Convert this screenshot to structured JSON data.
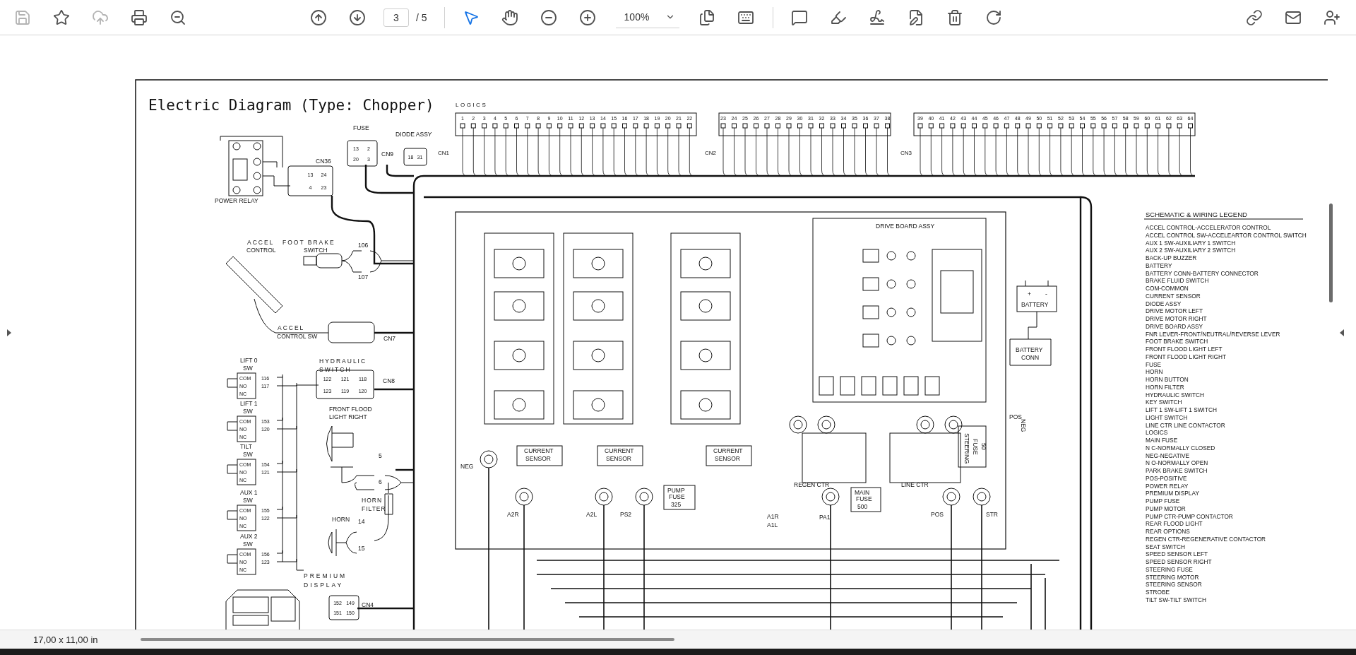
{
  "toolbar": {
    "page_current": "3",
    "page_total": "/ 5",
    "zoom": "100%"
  },
  "diagram": {
    "title": "Electric Diagram (Type: Chopper)",
    "logics_label": "LOGICS",
    "logic_groups": [
      {
        "connector": "CN1",
        "pins": [
          "1",
          "2",
          "3",
          "4",
          "5",
          "6",
          "7",
          "8",
          "9",
          "10",
          "11",
          "12",
          "13",
          "14",
          "15",
          "16",
          "17",
          "18",
          "19",
          "20",
          "21",
          "22"
        ]
      },
      {
        "connector": "CN2",
        "pins": [
          "23",
          "24",
          "25",
          "26",
          "27",
          "28",
          "29",
          "30",
          "31",
          "32",
          "33",
          "34",
          "35",
          "36",
          "37",
          "38"
        ]
      },
      {
        "connector": "CN3",
        "pins": [
          "39",
          "40",
          "41",
          "42",
          "43",
          "44",
          "45",
          "46",
          "47",
          "48",
          "49",
          "50",
          "51",
          "52",
          "53",
          "54",
          "55",
          "56",
          "57",
          "58",
          "59",
          "60",
          "61",
          "62",
          "63",
          "64"
        ]
      }
    ],
    "connector_blocks": [
      {
        "cells": [
          "13",
          "24",
          "4",
          "23"
        ]
      },
      {
        "cells": [
          "13",
          "2",
          "20",
          "3"
        ]
      },
      {
        "cells": [
          "18",
          "31"
        ]
      },
      {
        "cells": [
          "122",
          "121",
          "118",
          "123",
          "119",
          "120"
        ]
      },
      {
        "cells": [
          "152",
          "149",
          "151",
          "150"
        ]
      }
    ],
    "switch_blocks": [
      {
        "name": "LIFT 0",
        "suffix": "SW",
        "pins": [
          "COM",
          "NO",
          "NC"
        ],
        "wires": [
          "116",
          "117"
        ]
      },
      {
        "name": "LIFT 1",
        "suffix": "SW",
        "pins": [
          "COM",
          "NO",
          "NC"
        ],
        "wires": [
          "153",
          "120"
        ]
      },
      {
        "name": "TILT",
        "suffix": "SW",
        "pins": [
          "COM",
          "NO",
          "NC"
        ],
        "wires": [
          "154",
          "121"
        ]
      },
      {
        "name": "AUX 1",
        "suffix": "SW",
        "pins": [
          "COM",
          "NO",
          "NC"
        ],
        "wires": [
          "155",
          "122"
        ]
      },
      {
        "name": "AUX 2",
        "suffix": "SW",
        "pins": [
          "COM",
          "NO",
          "NC"
        ],
        "wires": [
          "156",
          "123"
        ]
      }
    ],
    "labels": [
      "FUSE",
      "CN9",
      "DIODE ASSY",
      "CN36",
      "POWER RELAY",
      "ACCEL",
      "CONTROL",
      "FOOT BRAKE",
      "SWITCH",
      "106",
      "107",
      "ACCEL",
      "CONTROL SW",
      "CN7",
      "HYDRAULIC",
      "SWITCH",
      "CN8",
      "FRONT FLOOD",
      "LIGHT RIGHT",
      "HORN",
      "FILTER",
      "HORN",
      "14",
      "15",
      "5",
      "6",
      "PREMIUM",
      "DISPLAY",
      "CN4",
      "DRIVE BOARD ASSY",
      "BATTERY",
      "+",
      "-",
      "BATTERY",
      "CONN",
      "POS",
      "NEG",
      "CURRENT",
      "SENSOR",
      "CURRENT",
      "SENSOR",
      "CURRENT",
      "SENSOR",
      "NEG",
      "A2R",
      "A2L",
      "PS2",
      "PUMP",
      "FUSE",
      "325",
      "A1R",
      "A1L",
      "REGEN CTR",
      "PA1",
      "MAIN",
      "FUSE",
      "500",
      "LINE CTR",
      "POS",
      "STR",
      "STEERING",
      "FUSE",
      "50"
    ],
    "legend": {
      "title": "SCHEMATIC & WIRING LEGEND",
      "entries": [
        "ACCEL CONTROL-ACCELERATOR CONTROL",
        "ACCEL CONTROL SW-ACCELEARTOR CONTROL SWITCH",
        "AUX 1 SW-AUXILIARY 1 SWITCH",
        "AUX 2 SW-AUXILIARY 2 SWITCH",
        "BACK-UP BUZZER",
        "BATTERY",
        "BATTERY CONN-BATTERY CONNECTOR",
        "BRAKE FLUID SWITCH",
        "COM-COMMON",
        "CURRENT SENSOR",
        "DIODE ASSY",
        "DRIVE MOTOR LEFT",
        "DRIVE MOTOR RIGHT",
        "DRIVE BOARD ASSY",
        "FNR LEVER-FRONT/NEUTRAL/REVERSE LEVER",
        "FOOT BRAKE SWITCH",
        "FRONT FLOOD LIGHT LEFT",
        "FRONT FLOOD LIGHT RIGHT",
        "FUSE",
        "HORN",
        "HORN BUTTON",
        "HORN FILTER",
        "HYDRAULIC SWITCH",
        "KEY SWITCH",
        "LIFT 1 SW-LIFT 1 SWITCH",
        "LIGHT SWITCH",
        "LINE CTR LINE CONTACTOR",
        "LOGICS",
        "MAIN FUSE",
        "N C-NORMALLY CLOSED",
        "NEG-NEGATIVE",
        "N O-NORMALLY OPEN",
        "PARK BRAKE SWITCH",
        "POS-POSITIVE",
        "POWER RELAY",
        "PREMIUM DISPLAY",
        "PUMP FUSE",
        "PUMP MOTOR",
        "PUMP CTR-PUMP CONTACTOR",
        "REAR FLOOD LIGHT",
        "REAR OPTIONS",
        "REGEN CTR-REGENERATIVE CONTACTOR",
        "SEAT SWITCH",
        "SPEED SENSOR LEFT",
        "SPEED SENSOR RIGHT",
        "STEERING FUSE",
        "STEERING MOTOR",
        "STEERING SENSOR",
        "STROBE",
        "TILT SW-TILT SWITCH"
      ]
    }
  },
  "status_bar": {
    "page_size": "17,00 x 11,00 in"
  }
}
